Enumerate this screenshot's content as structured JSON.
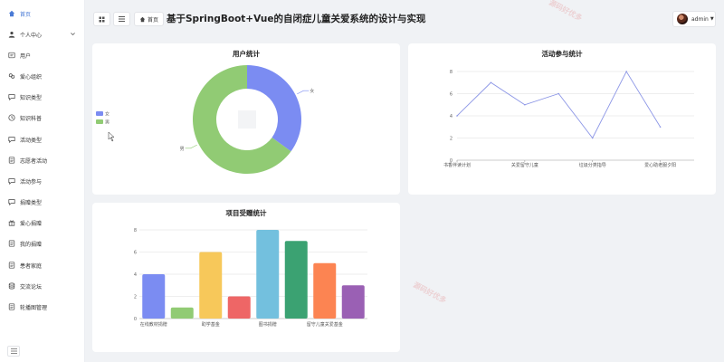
{
  "colors": {
    "accent": "#4a7bd6",
    "pie_male": "#7b8cf2",
    "pie_female": "#91cb74",
    "line": "#8c96e6"
  },
  "header": {
    "grid_icon": "grid-icon",
    "list_icon": "list-icon",
    "breadcrumb_icon": "home-icon",
    "breadcrumb": "首页",
    "title": "基于SpringBoot+Vue的自闭症儿童关爱系统的设计与实现",
    "user": "admin"
  },
  "sidebar": {
    "items": [
      {
        "label": "首页",
        "icon": "home-icon",
        "active": true
      },
      {
        "label": "个人中心",
        "icon": "user-icon",
        "expandable": true
      },
      {
        "label": "用户",
        "icon": "users-icon"
      },
      {
        "label": "爱心组织",
        "icon": "organization-icon"
      },
      {
        "label": "知识类型",
        "icon": "chat-icon"
      },
      {
        "label": "知识科普",
        "icon": "clock-icon"
      },
      {
        "label": "活动类型",
        "icon": "chat-icon"
      },
      {
        "label": "志愿者活动",
        "icon": "document-icon"
      },
      {
        "label": "活动参与",
        "icon": "chat-icon"
      },
      {
        "label": "捐赠类型",
        "icon": "chat-icon"
      },
      {
        "label": "爱心捐赠",
        "icon": "gift-icon"
      },
      {
        "label": "我的捐赠",
        "icon": "document-icon"
      },
      {
        "label": "患者家庭",
        "icon": "document-icon"
      },
      {
        "label": "交流论坛",
        "icon": "database-icon"
      },
      {
        "label": "轮播图管理",
        "icon": "document-icon"
      }
    ],
    "collapse_icon": "menu-icon"
  },
  "watermarks": [
    "源码好优多",
    "源码好优多"
  ],
  "chart_data": [
    {
      "type": "pie",
      "title": "用户统计",
      "donut": true,
      "legend_position": "left",
      "slices": [
        {
          "label": "女",
          "value": 35,
          "color": "#7b8cf2"
        },
        {
          "label": "男",
          "value": 65,
          "color": "#91cb74"
        }
      ]
    },
    {
      "type": "line",
      "title": "活动参与统计",
      "categories": [
        "书香伴读计划",
        "",
        "关爱留守儿童",
        "",
        "垃圾分类指导",
        "",
        "爱心助老服夕阳",
        ""
      ],
      "values": [
        4,
        7,
        5,
        6,
        2,
        8,
        3
      ],
      "ylim": [
        0,
        8
      ],
      "yticks": [
        0,
        2,
        4,
        6,
        8
      ],
      "grid": true,
      "xticks": [
        "书香伴读计划",
        "关爱留守儿童",
        "垃圾分类指导",
        "爱心助老服夕阳"
      ]
    },
    {
      "type": "bar",
      "title": "项目受赠统计",
      "values": [
        4,
        1,
        6,
        2,
        8,
        7,
        5,
        3
      ],
      "colors": [
        "#7b8cf2",
        "#91cb74",
        "#f7c85a",
        "#ee6666",
        "#73c0de",
        "#3ba272",
        "#fc8452",
        "#9a60b4"
      ],
      "xticks": [
        "在线教材捐赠",
        "助学基金",
        "图书捐赠",
        "留守儿童关爱基金"
      ],
      "ylim": [
        0,
        8
      ],
      "yticks": [
        0,
        2,
        4,
        6,
        8
      ],
      "grid": true
    }
  ]
}
